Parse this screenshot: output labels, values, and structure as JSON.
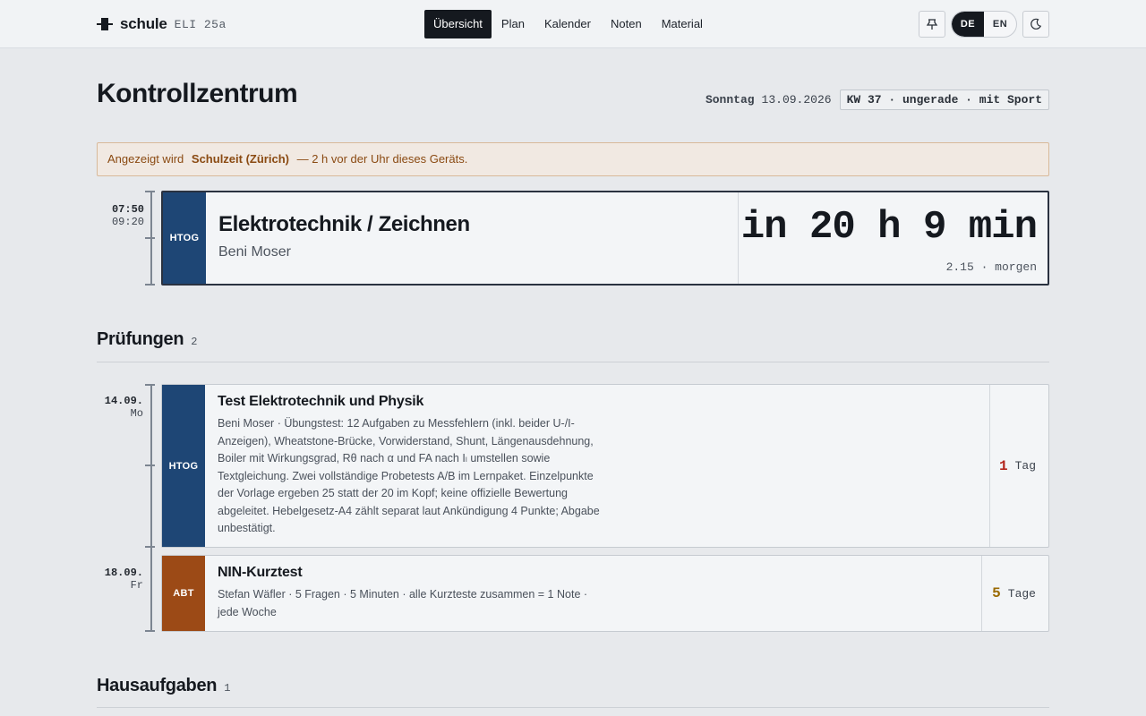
{
  "brand": {
    "name": "schule",
    "class": "ELI 25a"
  },
  "nav": [
    {
      "label": "Übersicht",
      "active": true
    },
    {
      "label": "Plan"
    },
    {
      "label": "Kalender"
    },
    {
      "label": "Noten"
    },
    {
      "label": "Material"
    }
  ],
  "toolbar": {
    "pin_icon": "pin-icon",
    "lang_de": "DE",
    "lang_en": "EN",
    "theme_icon": "moon-icon"
  },
  "header": {
    "title": "Kontrollzentrum",
    "weekday": "Sonntag",
    "date": "13.09.2026",
    "week_badge": "KW 37 · ungerade · mit Sport"
  },
  "notice": {
    "prefix": "Angezeigt wird",
    "timezone": "Schulzeit (Zürich)",
    "suffix": "— 2 h vor der Uhr dieses Geräts."
  },
  "next_lesson": {
    "start": "07:50",
    "end": "09:20",
    "tag": "HTOG",
    "subject": "Elektrotechnik / Zeichnen",
    "teacher": "Beni Moser",
    "countdown": "in 20 h 9 min",
    "room_info": "2.15 · morgen"
  },
  "exams": {
    "title": "Prüfungen",
    "count": "2",
    "items": [
      {
        "date": "14.09.",
        "weekday": "Mo",
        "tag": "HTOG",
        "title": "Test Elektrotechnik und Physik",
        "description": "Beni Moser · Übungstest: 12 Aufgaben zu Messfehlern (inkl. beider U-/I-Anzeigen), Wheatstone-Brücke, Vorwiderstand, Shunt, Längenausdehnung, Boiler mit Wirkungsgrad, Rθ nach α und FA nach Iₗ umstellen sowie Textgleichung. Zwei vollständige Probetests A/B im Lernpaket. Einzelpunkte der Vorlage ergeben 25 statt der 20 im Kopf; keine offizielle Bewertung abgeleitet. Hebelgesetz-A4 zählt separat laut Ankündigung 4 Punkte; Abgabe unbestätigt.",
        "days": "1",
        "days_unit": "Tag",
        "days_color": "#b3261e"
      },
      {
        "date": "18.09.",
        "weekday": "Fr",
        "tag": "ABT",
        "title": "NIN-Kurztest",
        "description": "Stefan Wäfler · 5 Fragen · 5 Minuten · alle Kurzteste zusammen = 1 Note · jede Woche",
        "days": "5",
        "days_unit": "Tage",
        "days_color": "#9a6a00"
      }
    ]
  },
  "homework": {
    "title": "Hausaufgaben",
    "count": "1"
  },
  "colors": {
    "tag_htog": "#1e4675",
    "tag_abt": "#9c4a16",
    "notice_text": "#8a4a12"
  }
}
